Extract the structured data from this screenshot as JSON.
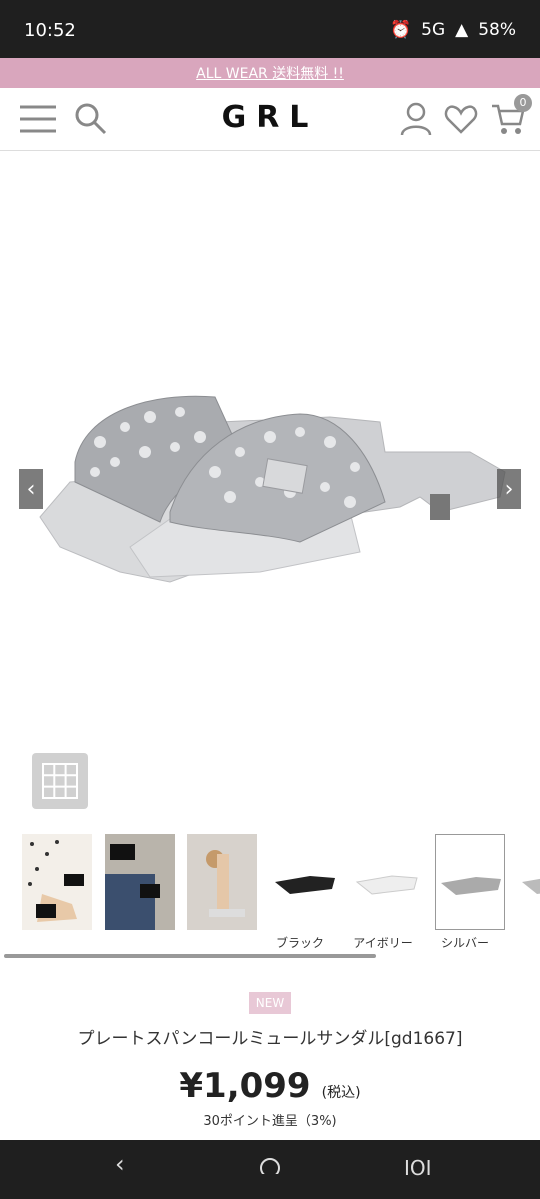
{
  "status": {
    "time": "10:52",
    "network": "5G",
    "battery": "58%"
  },
  "banner": {
    "text": "ALL WEAR 送料無料 !!"
  },
  "header": {
    "logo": "GRL",
    "cart_count": "0"
  },
  "product": {
    "main_image": "silver sequin slide sandals",
    "new_tag": "NEW",
    "title": "プレートスパンコールミュールサンダル[gd1667]",
    "price": "¥1,099",
    "tax_label": "(税込)",
    "points": "30ポイント進呈（3%)"
  },
  "thumbnails": [
    {
      "label": ""
    },
    {
      "label": ""
    },
    {
      "label": ""
    },
    {
      "label": "ブラック"
    },
    {
      "label": "アイボリー"
    },
    {
      "label": "シルバー"
    },
    {
      "label": ""
    }
  ],
  "colors": {
    "banner": "#d9a6bd",
    "new_tag": "#e8c8d6"
  }
}
